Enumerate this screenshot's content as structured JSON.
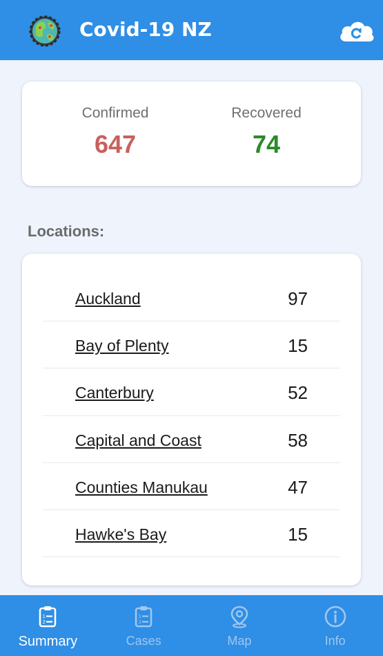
{
  "app_bar": {
    "title": "Covid-19 NZ",
    "logo_icon": "globe-virus-icon",
    "refresh_icon": "cloud-refresh-icon"
  },
  "summary": {
    "confirmed_label": "Confirmed",
    "confirmed_value": "647",
    "recovered_label": "Recovered",
    "recovered_value": "74"
  },
  "locations": {
    "heading": "Locations:",
    "items": [
      {
        "name": "Auckland",
        "count": "97"
      },
      {
        "name": "Bay of Plenty",
        "count": "15"
      },
      {
        "name": "Canterbury",
        "count": "52"
      },
      {
        "name": "Capital and Coast",
        "count": "58"
      },
      {
        "name": "Counties Manukau",
        "count": "47"
      },
      {
        "name": "Hawke's Bay",
        "count": "15"
      }
    ]
  },
  "bottom_nav": {
    "items": [
      {
        "label": "Summary",
        "icon": "clipboard-list-icon",
        "active": true
      },
      {
        "label": "Cases",
        "icon": "clipboard-list-icon",
        "active": false
      },
      {
        "label": "Map",
        "icon": "map-pin-icon",
        "active": false
      },
      {
        "label": "Info",
        "icon": "info-icon",
        "active": false
      }
    ]
  },
  "colors": {
    "primary": "#2f8ee5",
    "background": "#eef3fc",
    "confirmed": "#c9605c",
    "recovered": "#2a8a2a",
    "nav_inactive": "#9fc7ef"
  }
}
